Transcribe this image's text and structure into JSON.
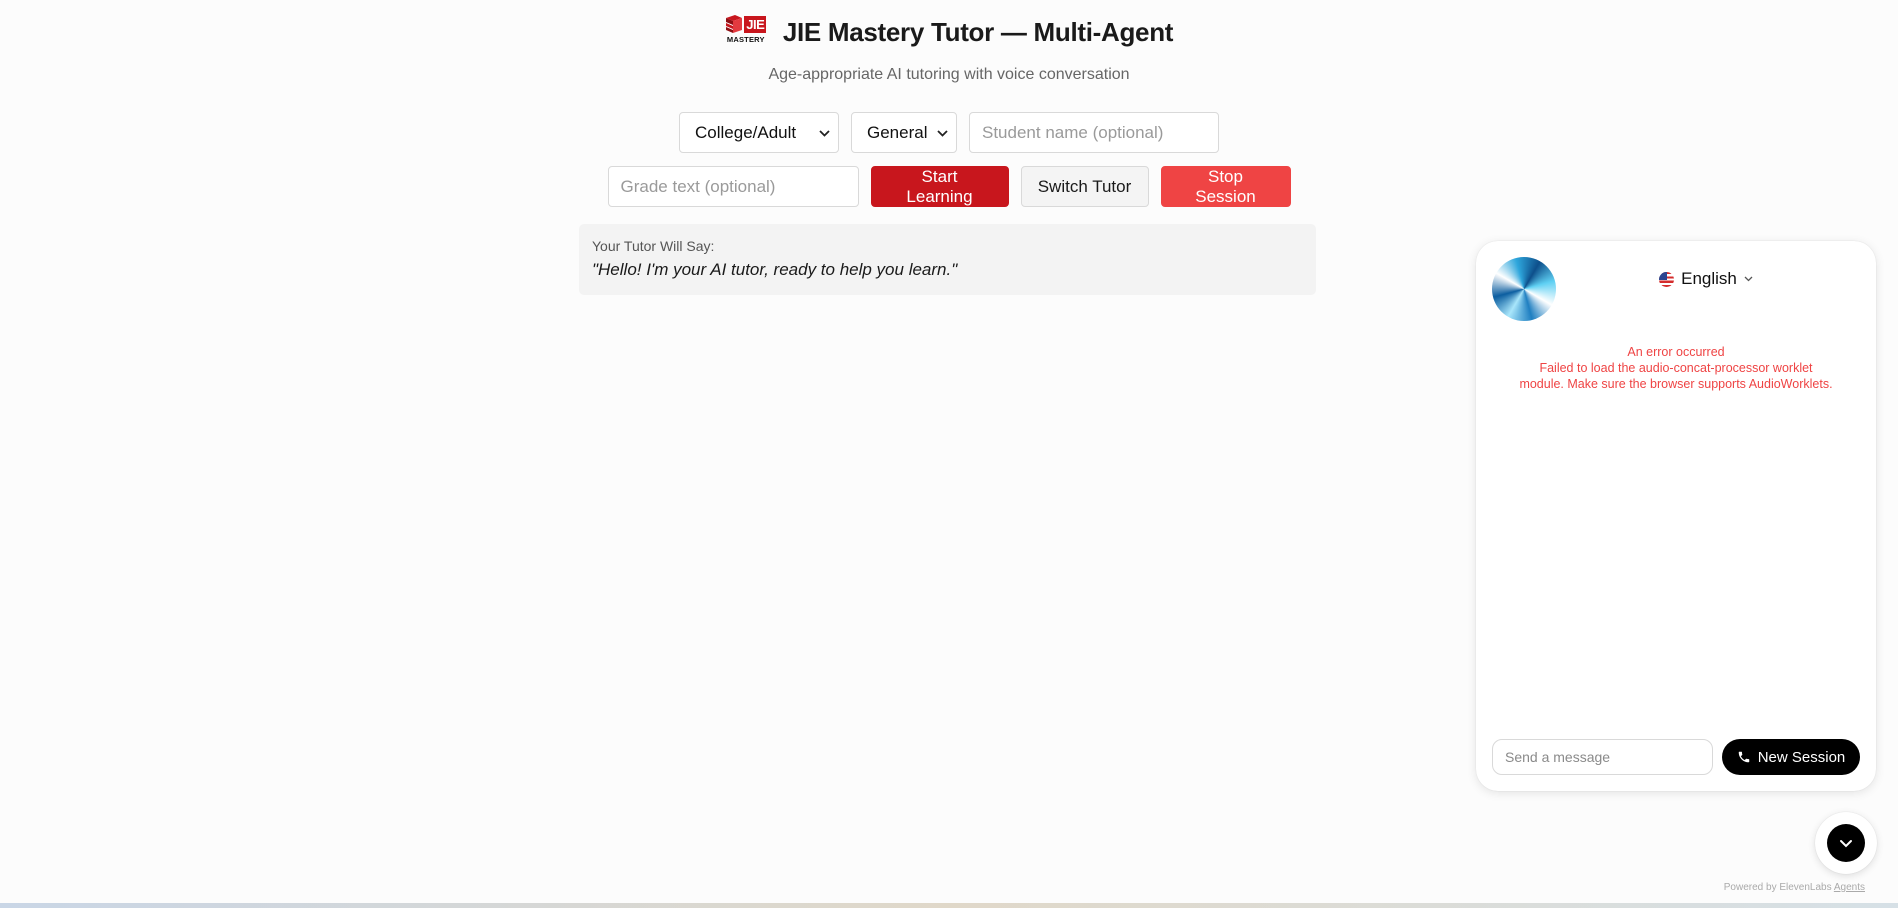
{
  "header": {
    "logo_badge": "JIE",
    "logo_caption": "MASTERY",
    "title": "JIE Mastery Tutor — Multi-Agent",
    "subtitle": "Age-appropriate AI tutoring with voice conversation"
  },
  "controls": {
    "level_select": "College/Adult",
    "subject_select": "General",
    "student_name_placeholder": "Student name (optional)",
    "grade_text_placeholder": "Grade text (optional)",
    "start_label": "Start Learning",
    "switch_label": "Switch Tutor",
    "stop_label": "Stop Session"
  },
  "tutor_say": {
    "label": "Your Tutor Will Say:",
    "text": "\"Hello! I'm your AI tutor, ready to help you learn.\""
  },
  "widget": {
    "language": "English",
    "error_title": "An error occurred",
    "error_message": "Failed to load the audio-concat-processor worklet module. Make sure the browser supports AudioWorklets.",
    "message_placeholder": "Send a message",
    "new_session_label": "New Session",
    "powered_by": "Powered by ElevenLabs",
    "powered_link": "Agents"
  },
  "colors": {
    "brand_red": "#c8161d",
    "stop_red": "#ef4444",
    "error_red": "#ef4444"
  },
  "icons": {
    "language_flag": "us-flag-icon",
    "phone": "phone-icon",
    "collapse": "chevron-down-icon"
  }
}
